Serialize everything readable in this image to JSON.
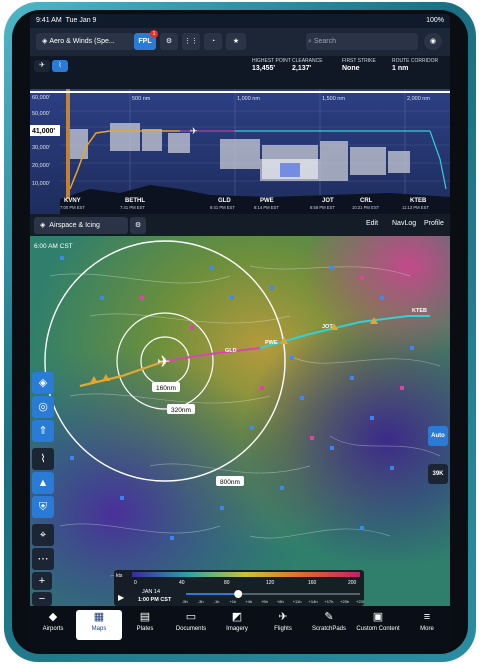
{
  "status": {
    "time": "9:41 AM",
    "date": "Tue Jan 9",
    "right": "100%"
  },
  "toolbar": {
    "layer_label": "Aero & Winds (Spe...",
    "fpl_label": "FPL",
    "fpl_badge": "1",
    "search_placeholder": "Search"
  },
  "profile_stats": [
    {
      "label": "HIGHEST POINT",
      "value": "13,455'"
    },
    {
      "label": "CLEARANCE",
      "value": "2,137'"
    },
    {
      "label": "FIRST STRIKE",
      "value": "None"
    },
    {
      "label": "ROUTE CORRIDOR",
      "value": "1 nm"
    }
  ],
  "profile": {
    "altitudes": [
      "60,000'",
      "50,000'",
      "41,000'",
      "30,000'",
      "20,000'",
      "10,000'"
    ],
    "current_alt": "41,000'",
    "distances": [
      "500 nm",
      "1,000 nm",
      "1,500 nm",
      "2,000 nm"
    ],
    "waypoints": [
      {
        "name": "KVNY",
        "time": "7:00 PM EST"
      },
      {
        "name": "BETHL",
        "time": "7:41 PM EST"
      },
      {
        "name": "GLD",
        "time": "8:41 PM EST"
      },
      {
        "name": "PWE",
        "time": "8:14 PM EST"
      },
      {
        "name": "JOT",
        "time": "8:58 PM EST"
      },
      {
        "name": "CRL",
        "time": "10:21 PM EST"
      },
      {
        "name": "KTEB",
        "time": "11:13 PM EST"
      }
    ]
  },
  "subtabs": {
    "layer": "Airspace & Icing",
    "edit": "Edit",
    "navlog": "NavLog",
    "profile": "Profile"
  },
  "map": {
    "time_label": "6:00 AM CST",
    "rings": [
      "160nm",
      "320nm",
      "800nm"
    ],
    "route_labels": [
      "GLD",
      "PWE",
      "JOT",
      "KTEB"
    ],
    "right_tools": [
      "Auto",
      "39K"
    ]
  },
  "timebar": {
    "unit": "kts",
    "scale": [
      "0",
      "40",
      "80",
      "120",
      "160",
      "200"
    ],
    "date": "JAN 14",
    "time": "1:00 PM CST",
    "ticks": [
      "-5h",
      "-3h",
      "-1h",
      "+1h",
      "+4h",
      "+5h",
      "+8h",
      "+11h",
      "+14h",
      "+17h",
      "+20h",
      "+23h"
    ],
    "position": 0.3
  },
  "nav": [
    {
      "label": "Airports",
      "icon": "◆"
    },
    {
      "label": "Maps",
      "icon": "▦"
    },
    {
      "label": "Plates",
      "icon": "▤"
    },
    {
      "label": "Documents",
      "icon": "▭"
    },
    {
      "label": "Imagery",
      "icon": "◩"
    },
    {
      "label": "Flights",
      "icon": "✈"
    },
    {
      "label": "ScratchPads",
      "icon": "✎"
    },
    {
      "label": "Custom Content",
      "icon": "▣"
    },
    {
      "label": "More",
      "icon": "≡"
    }
  ],
  "colors": {
    "route": "#31d0d6",
    "accent": "#2a7bd6",
    "ownship": "#ffffff",
    "profile_bg": "#2b3e7c"
  }
}
